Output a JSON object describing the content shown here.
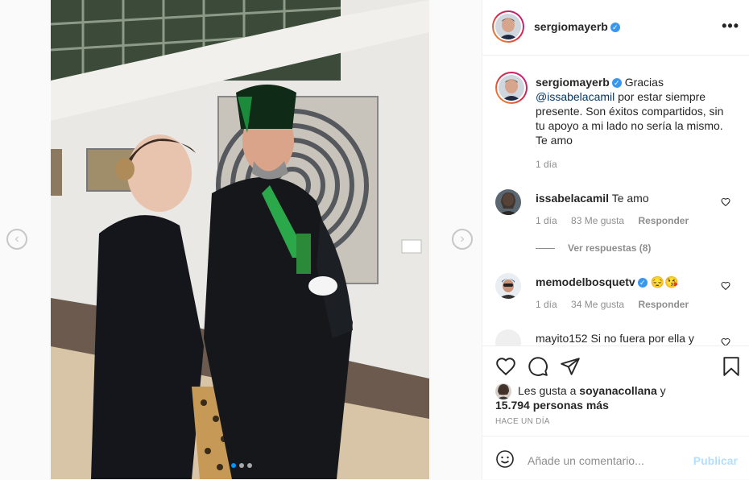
{
  "post": {
    "username": "sergiomayerb",
    "caption_text": "Gracias",
    "caption_mention": "@issabelacamil",
    "caption_rest": "por estar siempre presente. Son éxitos compartidos, sin tu apoyo a mi lado no sería la mismo. Te amo",
    "caption_time": "1 día",
    "slide_active": 1,
    "slide_count": 3
  },
  "comments": [
    {
      "username": "issabelacamil",
      "text": "Te amo",
      "time": "1 día",
      "likes": "83 Me gusta",
      "reply": "Responder",
      "view_replies": "Ver respuestas (8)"
    },
    {
      "username": "memodelbosquetv",
      "text": "😔😘",
      "time": "1 día",
      "likes": "34 Me gusta",
      "reply": "Responder"
    },
    {
      "username": "mayito152",
      "text": "Si no fuera por ella y"
    }
  ],
  "likes_summary": {
    "prefix": "Les gusta a",
    "user": "soyanacollana",
    "suffix": "y",
    "others": "15.794 personas más"
  },
  "posted_ago": "HACE UN DÍA",
  "add_comment": {
    "placeholder": "Añade un comentario...",
    "post_label": "Publicar"
  },
  "icons": {
    "prev": "chevron-left-icon",
    "next": "chevron-right-icon",
    "more": "more-options-icon",
    "like": "heart-icon",
    "comment": "comment-icon",
    "share": "paper-plane-icon",
    "save": "bookmark-icon",
    "emoji": "smiley-icon"
  },
  "colors": {
    "accent": "#0095f6",
    "verified": "#3897f0",
    "muted": "#8e8e8e",
    "post_disabled": "#b2dffc"
  }
}
